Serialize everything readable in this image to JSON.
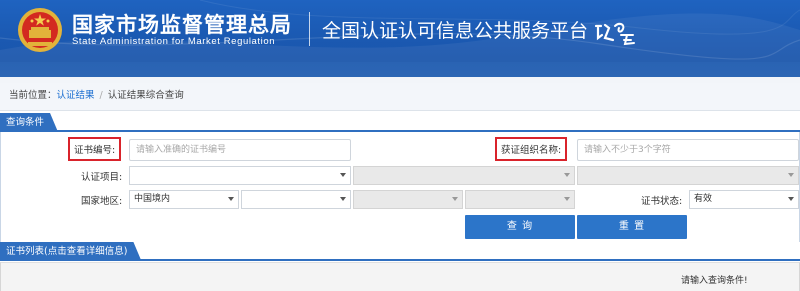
{
  "header": {
    "agency_cn": "国家市场监督管理总局",
    "agency_en": "State Administration for Market Regulation",
    "platform": "全国认证认可信息公共服务平台",
    "emblem_icon": "national-emblem-icon",
    "logo_icon": "renzheng-yun-logo-icon",
    "colors": {
      "banner": "#1b5ab3",
      "accent": "#2f6fc0",
      "highlight": "#d9232b"
    }
  },
  "breadcrumb": {
    "prefix": "当前位置：",
    "item1": "认证结果",
    "separator": "/",
    "item2": "认证结果综合查询"
  },
  "query_panel": {
    "title": "查询条件",
    "cert_no_label": "证书编号:",
    "cert_no_placeholder": "请输入准确的证书编号",
    "org_name_label": "获证组织名称:",
    "org_name_placeholder": "请输入不少于3个字符",
    "project_label": "认证项目:",
    "region_label": "国家地区:",
    "region_selected": "中国境内",
    "status_label": "证书状态:",
    "status_selected": "有效",
    "search_button": "查 询",
    "reset_button": "重 置"
  },
  "list_panel": {
    "title": "证书列表(点击查看详细信息)",
    "hint": "请输入查询条件!"
  }
}
